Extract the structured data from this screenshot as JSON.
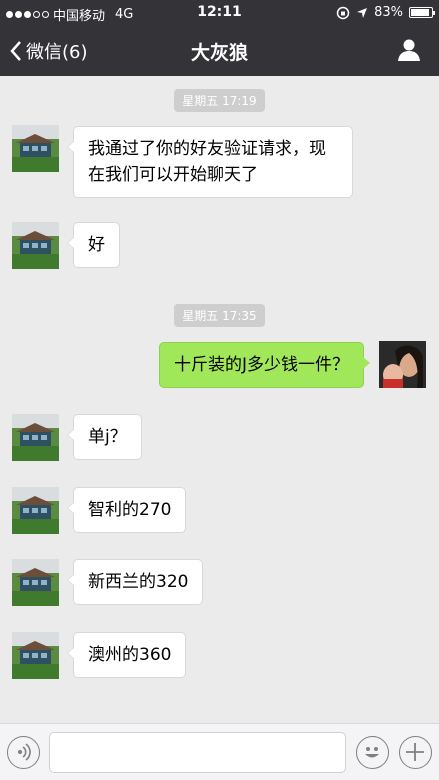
{
  "status": {
    "carrier": "中国移动",
    "network": "4G",
    "time": "12:11",
    "battery_text": "83%",
    "battery_level": 0.83
  },
  "nav": {
    "back_label": "微信(6)",
    "title": "大灰狼"
  },
  "chat": {
    "time_1": "星期五 17:19",
    "msg_1": "我通过了你的好友验证请求，现在我们可以开始聊天了",
    "msg_2": "好",
    "time_2": "星期五 17:35",
    "msg_3": "十斤装的J多少钱一件？",
    "msg_4": "单j？",
    "msg_5": "智利的270",
    "msg_6": "新西兰的320",
    "msg_7": "澳州的360"
  },
  "input": {
    "value": "",
    "placeholder": ""
  },
  "colors": {
    "bar": "#333338",
    "outgoing_bubble": "#a0e75a",
    "chat_bg": "#ebebeb"
  },
  "icons": [
    "back-chevron-icon",
    "person-icon",
    "voice-icon",
    "emoji-icon",
    "plus-icon",
    "location-arrow-icon",
    "lock-rotation-icon"
  ]
}
